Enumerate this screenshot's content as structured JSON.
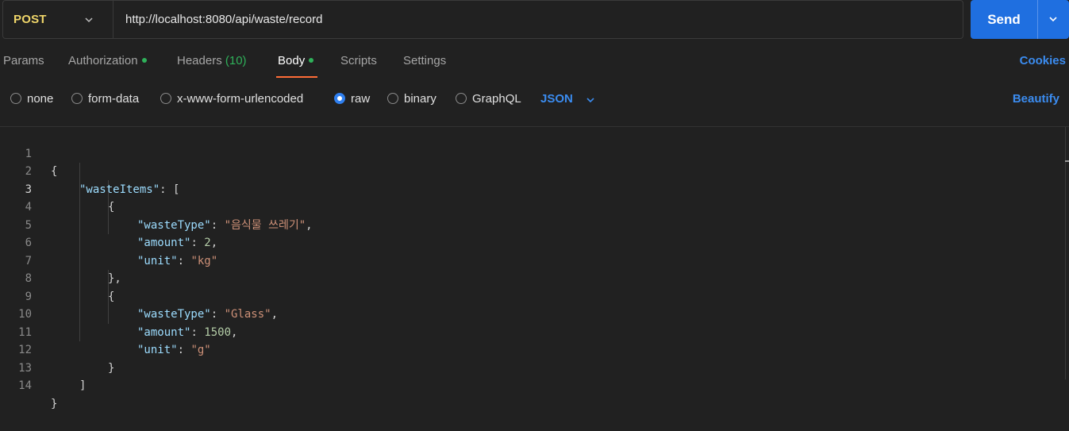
{
  "request": {
    "method": "POST",
    "url": "http://localhost:8080/api/waste/record",
    "send_label": "Send"
  },
  "tabs": [
    {
      "label": "Params"
    },
    {
      "label": "Authorization"
    },
    {
      "label": "Headers",
      "count": "(10)"
    },
    {
      "label": "Body"
    },
    {
      "label": "Scripts"
    },
    {
      "label": "Settings"
    }
  ],
  "active_tab": "Body",
  "cookies_label": "Cookies",
  "body_types": [
    {
      "label": "none"
    },
    {
      "label": "form-data"
    },
    {
      "label": "x-www-form-urlencoded"
    },
    {
      "label": "raw"
    },
    {
      "label": "binary"
    },
    {
      "label": "GraphQL"
    }
  ],
  "selected_body_type": "raw",
  "format": "JSON",
  "beautify_label": "Beautify",
  "colors": {
    "method": "#f0d66a",
    "send": "#1f6fe0",
    "accent": "#3b8cf0",
    "active_tab_underline": "#ff6c37",
    "dot": "#2fb15a",
    "json_key": "#9cdcfe",
    "json_string": "#ce9178",
    "json_number": "#b5cea8"
  },
  "editor": {
    "current_line": 3,
    "line_numbers": [
      "1",
      "2",
      "3",
      "4",
      "5",
      "6",
      "7",
      "8",
      "9",
      "10",
      "11",
      "12",
      "13",
      "14"
    ],
    "tokens": {
      "l1_open": "{",
      "l2_key": "\"wasteItems\"",
      "l2_rest": ": [",
      "l3_open": "{",
      "l4_key": "\"wasteType\"",
      "l4_colon": ": ",
      "l4_val": "\"음식물 쓰레기\"",
      "l4_comma": ",",
      "l5_key": "\"amount\"",
      "l5_colon": ": ",
      "l5_val": "2",
      "l5_comma": ",",
      "l6_key": "\"unit\"",
      "l6_colon": ": ",
      "l6_val": "\"kg\"",
      "l7_close": "},",
      "l8_open": "{",
      "l9_key": "\"wasteType\"",
      "l9_colon": ": ",
      "l9_val": "\"Glass\"",
      "l9_comma": ",",
      "l10_key": "\"amount\"",
      "l10_colon": ": ",
      "l10_val": "1500",
      "l10_comma": ",",
      "l11_key": "\"unit\"",
      "l11_colon": ": ",
      "l11_val": "\"g\"",
      "l12_close": "}",
      "l13_close": "]",
      "l14_close": "}"
    }
  }
}
